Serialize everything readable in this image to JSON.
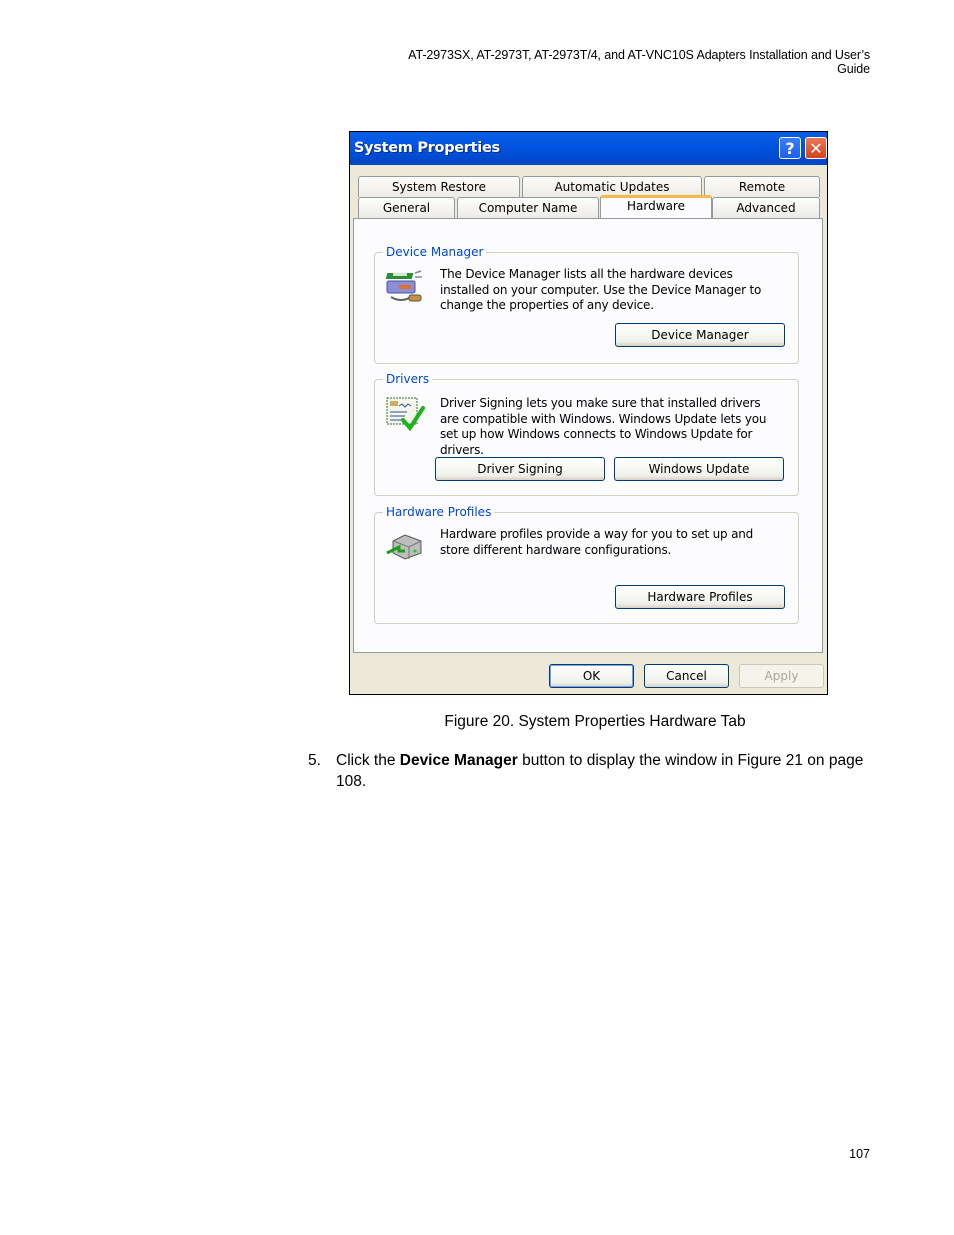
{
  "running_header": "AT-2973SX, AT-2973T, AT-2973T/4, and AT-VNC10S Adapters Installation and User’s Guide",
  "dialog": {
    "title": "System Properties",
    "title_buttons": {
      "help": "?",
      "close": "✕"
    },
    "tabs_row1": [
      {
        "label": "System Restore"
      },
      {
        "label": "Automatic Updates"
      },
      {
        "label": "Remote"
      }
    ],
    "tabs_row2": [
      {
        "label": "General"
      },
      {
        "label": "Computer Name"
      },
      {
        "label": "Hardware",
        "active": true
      },
      {
        "label": "Advanced"
      }
    ],
    "groups": {
      "device_manager": {
        "label": "Device Manager",
        "icon": "device-manager-icon",
        "text": "The Device Manager lists all the hardware devices installed on your computer. Use the Device Manager to change the properties of any device.",
        "button": "Device Manager"
      },
      "drivers": {
        "label": "Drivers",
        "icon": "driver-signing-icon",
        "text": "Driver Signing lets you make sure that installed drivers are compatible with Windows. Windows Update lets you set up how Windows connects to Windows Update for drivers.",
        "buttons": {
          "driver_signing": "Driver Signing",
          "windows_update": "Windows Update"
        }
      },
      "hardware_profiles": {
        "label": "Hardware Profiles",
        "icon": "hardware-profiles-icon",
        "text": "Hardware profiles provide a way for you to set up and store different hardware configurations.",
        "button": "Hardware Profiles"
      }
    },
    "footer_buttons": {
      "ok": "OK",
      "cancel": "Cancel",
      "apply": "Apply"
    }
  },
  "caption": "Figure 20. System Properties Hardware Tab",
  "step": {
    "number": "5.",
    "pre": "Click the ",
    "bold": "Device Manager",
    "post": " button to display the window in Figure 21 on page 108."
  },
  "page_number": "107"
}
